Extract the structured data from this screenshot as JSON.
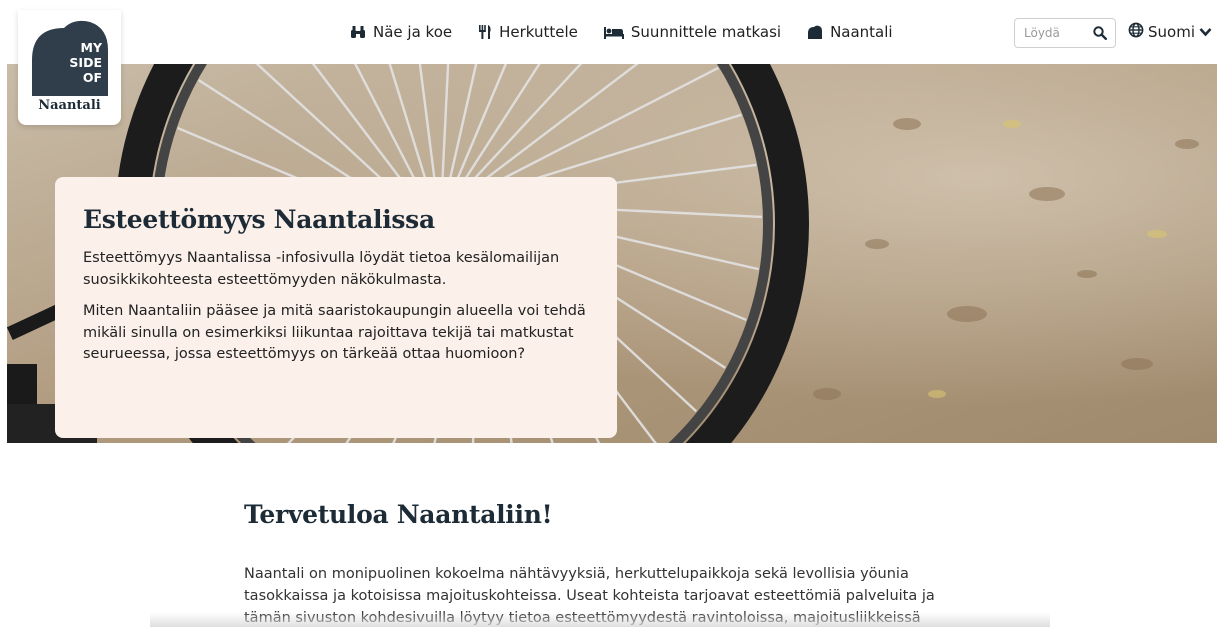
{
  "logo": {
    "lines": [
      "MY",
      "SIDE",
      "OF"
    ],
    "word": "Naantali"
  },
  "nav": [
    {
      "label": "Näe ja koe",
      "icon": "binoculars-icon"
    },
    {
      "label": "Herkuttele",
      "icon": "utensils-icon"
    },
    {
      "label": "Suunnittele matkasi",
      "icon": "bed-icon"
    },
    {
      "label": "Naantali",
      "icon": "heart-icon"
    }
  ],
  "search": {
    "placeholder": "Löydä",
    "icon": "search-icon"
  },
  "language": {
    "label": "Suomi",
    "icon": "globe-icon",
    "chevron": "chevron-down-icon"
  },
  "hero": {
    "title": "Esteettömyys Naantalissa",
    "p1": "Esteettömyys Naantalissa -infosivulla löydät tietoa kesälomailijan suosikkikohteesta esteettömyyden näkökulmasta.",
    "p2": "Miten Naantaliin pääsee ja mitä saaristokaupungin alueella voi tehdä mikäli sinulla on esimerkiksi liikuntaa rajoittava tekijä tai matkustat seurueessa, jossa esteettömyys on tärkeää ottaa huomioon?"
  },
  "main": {
    "title": "Tervetuloa Naantaliin!",
    "body": "Naantali on monipuolinen kokoelma nähtävyyksiä, herkuttelupaikkoja sekä levollisia yöunia tasokkaissa ja kotoisissa majoituskohteissa. Useat kohteista tarjoavat esteettömiä palveluita ja tämän sivuston kohdesivuilla löytyy tietoa esteettömyydestä ravintoloissa, majoitusliikkeissä"
  },
  "colors": {
    "brand_dark": "#1d2b36",
    "card_bg": "#fbf1ea"
  }
}
